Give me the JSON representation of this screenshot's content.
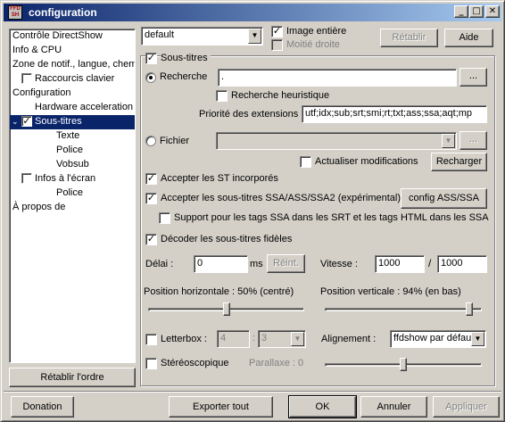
{
  "window": {
    "title": "configuration",
    "app_icon_text": "FFD SH"
  },
  "tree": {
    "items": [
      {
        "label": "Contrôle DirectShow"
      },
      {
        "label": "Info & CPU"
      },
      {
        "label": "Zone de notif., langue, chem"
      },
      {
        "label": "Raccourcis clavier"
      },
      {
        "label": "Configuration"
      },
      {
        "label": "Hardware acceleration"
      },
      {
        "label": "Sous-titres"
      },
      {
        "label": "Texte"
      },
      {
        "label": "Police"
      },
      {
        "label": "Vobsub"
      },
      {
        "label": "Infos à l'écran"
      },
      {
        "label": "Police"
      },
      {
        "label": "À propos de"
      }
    ],
    "reset_button": "Rétablir l'ordre"
  },
  "top": {
    "preset_value": "default",
    "image_entiere": "Image entière",
    "moitie_droite": "Moitié droite",
    "retablir": "Rétablir",
    "aide": "Aide"
  },
  "subs": {
    "enable_label": "Sous-titres",
    "recherche_label": "Recherche",
    "recherche_value": ".",
    "browse": "...",
    "heuristic_label": "Recherche heuristique",
    "priority_label": "Priorité des extensions",
    "priority_value": "utf;idx;sub;srt;smi;rt;txt;ass;ssa;aqt;mp",
    "fichier_label": "Fichier",
    "fichier_value": "",
    "fichier_browse": "...",
    "actualiser_label": "Actualiser modifications",
    "recharger": "Recharger",
    "accept_embedded": "Accepter les ST incorporés",
    "accept_ssa": "Accepter les sous-titres SSA/ASS/SSA2 (expérimental)",
    "config_ssa": "config ASS/SSA",
    "support_tags": "Support pour les tags SSA dans les SRT et les tags HTML dans les SSA",
    "decode_faithful": "Décoder les sous-titres fidèles",
    "delai_label": "Délai :",
    "delai_value": "0",
    "delai_unit": "ms",
    "reinit": "Réint.",
    "vitesse_label": "Vitesse :",
    "vitesse_num": "1000",
    "vitesse_sep": "/",
    "vitesse_den": "1000",
    "pos_h_label": "Position horizontale :  50% (centré)",
    "pos_v_label": "Position verticale :  94% (en bas)",
    "pos_h_value": 0.5,
    "pos_v_value": 0.94,
    "letterbox_label": "Letterbox :",
    "letterbox_a": "4",
    "letterbox_sep": ":",
    "letterbox_b": "3",
    "alignement_label": "Alignement :",
    "alignement_value": "ffdshow par défaut",
    "stereo_label": "Stéréoscopique",
    "parallaxe_label": "Parallaxe : 0",
    "parallaxe_value": 0.5
  },
  "footer": {
    "donation": "Donation",
    "exporter": "Exporter tout",
    "ok": "OK",
    "annuler": "Annuler",
    "appliquer": "Appliquer"
  }
}
